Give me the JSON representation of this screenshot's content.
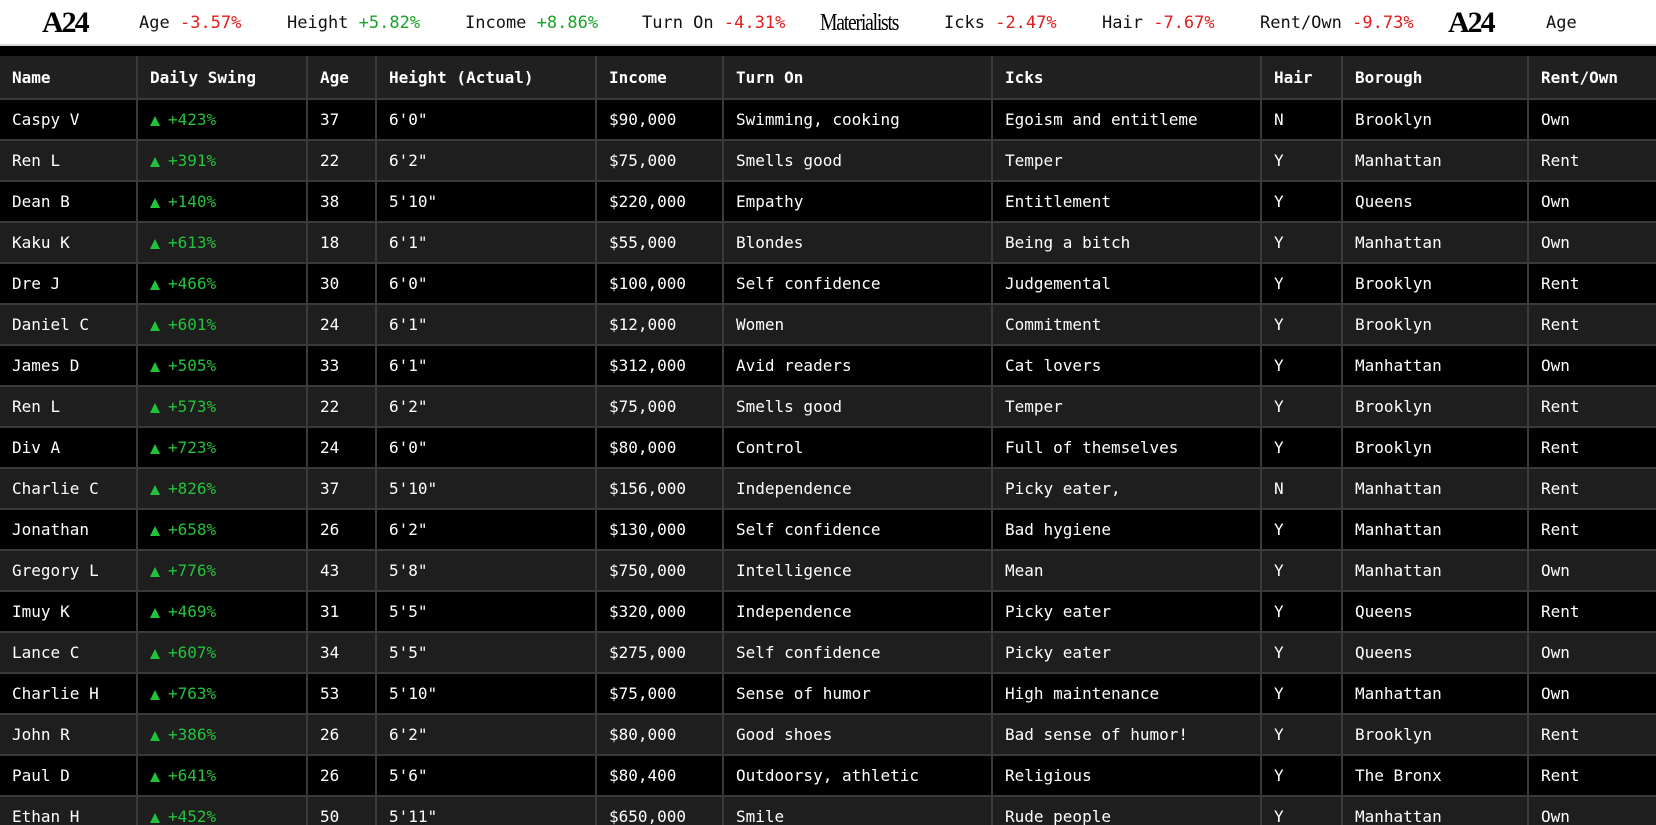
{
  "ticker": {
    "items": [
      {
        "type": "logo",
        "text": "A24"
      },
      {
        "type": "stat",
        "label": "Age",
        "value": "-3.57%",
        "trend": "down"
      },
      {
        "type": "stat",
        "label": "Height",
        "value": "+5.82%",
        "trend": "up"
      },
      {
        "type": "stat",
        "label": "Income",
        "value": "+8.86%",
        "trend": "up"
      },
      {
        "type": "stat",
        "label": "Turn On",
        "value": "-4.31%",
        "trend": "down"
      },
      {
        "type": "logo2",
        "text": "Materialists"
      },
      {
        "type": "stat",
        "label": "Icks",
        "value": "-2.47%",
        "trend": "down"
      },
      {
        "type": "stat",
        "label": "Hair",
        "value": "-7.67%",
        "trend": "down"
      },
      {
        "type": "stat",
        "label": "Rent/Own",
        "value": "-9.73%",
        "trend": "down"
      },
      {
        "type": "logo",
        "text": "A24"
      },
      {
        "type": "stat",
        "label": "Age",
        "value": "",
        "trend": "down"
      }
    ]
  },
  "table": {
    "headers": [
      "Name",
      "Daily Swing",
      "Age",
      "Height (Actual)",
      "Income",
      "Turn On",
      "Icks",
      "Hair",
      "Borough",
      "Rent/Own"
    ],
    "rows": [
      [
        "Caspy V",
        "+423%",
        "37",
        "6'0\"",
        "$90,000",
        "Swimming, cooking",
        "Egoism and entitleme",
        "N",
        "Brooklyn",
        "Own"
      ],
      [
        "Ren L",
        "+391%",
        "22",
        "6'2\"",
        "$75,000",
        "Smells good",
        "Temper",
        "Y",
        "Manhattan",
        "Rent"
      ],
      [
        "Dean B",
        "+140%",
        "38",
        "5'10\"",
        "$220,000",
        "Empathy",
        "Entitlement",
        "Y",
        "Queens",
        "Own"
      ],
      [
        "Kaku K",
        "+613%",
        "18",
        "6'1\"",
        "$55,000",
        "Blondes",
        "Being a bitch",
        "Y",
        "Manhattan",
        "Own"
      ],
      [
        "Dre J",
        "+466%",
        "30",
        "6'0\"",
        "$100,000",
        "Self confidence",
        "Judgemental",
        "Y",
        "Brooklyn",
        "Rent"
      ],
      [
        "Daniel C",
        "+601%",
        "24",
        "6'1\"",
        "$12,000",
        "Women",
        "Commitment",
        "Y",
        "Brooklyn",
        "Rent"
      ],
      [
        "James D",
        "+505%",
        "33",
        "6'1\"",
        "$312,000",
        "Avid readers",
        "Cat lovers",
        "Y",
        "Manhattan",
        "Own"
      ],
      [
        "Ren L",
        "+573%",
        "22",
        "6'2\"",
        "$75,000",
        "Smells good",
        "Temper",
        "Y",
        "Brooklyn",
        "Rent"
      ],
      [
        "Div A",
        "+723%",
        "24",
        "6'0\"",
        "$80,000",
        "Control",
        "Full of themselves",
        "Y",
        "Brooklyn",
        "Rent"
      ],
      [
        "Charlie C",
        "+826%",
        "37",
        "5'10\"",
        "$156,000",
        "Independence",
        "Picky eater,",
        "N",
        "Manhattan",
        "Rent"
      ],
      [
        "Jonathan",
        "+658%",
        "26",
        "6'2\"",
        "$130,000",
        "Self confidence",
        "Bad hygiene",
        "Y",
        "Manhattan",
        "Rent"
      ],
      [
        "Gregory L",
        "+776%",
        "43",
        "5'8\"",
        "$750,000",
        "Intelligence",
        "Mean",
        "Y",
        "Manhattan",
        "Own"
      ],
      [
        "Imuy K",
        "+469%",
        "31",
        "5'5\"",
        "$320,000",
        "Independence",
        "Picky eater",
        "Y",
        "Queens",
        "Rent"
      ],
      [
        "Lance C",
        "+607%",
        "34",
        "5'5\"",
        "$275,000",
        "Self confidence",
        "Picky eater",
        "Y",
        "Queens",
        "Own"
      ],
      [
        "Charlie H",
        "+763%",
        "53",
        "5'10\"",
        "$75,000",
        "Sense of humor",
        "High maintenance",
        "Y",
        "Manhattan",
        "Own"
      ],
      [
        "John R",
        "+386%",
        "26",
        "6'2\"",
        "$80,000",
        "Good shoes",
        "Bad sense of humor!",
        "Y",
        "Brooklyn",
        "Rent"
      ],
      [
        "Paul D",
        "+641%",
        "26",
        "5'6\"",
        "$80,400",
        "Outdoorsy, athletic",
        "Religious",
        "Y",
        "The Bronx",
        "Rent"
      ],
      [
        "Ethan H",
        "+452%",
        "50",
        "5'11\"",
        "$650,000",
        "Smile",
        "Rude people",
        "Y",
        "Manhattan",
        "Own"
      ]
    ]
  },
  "colors": {
    "up": "#19a32a",
    "down": "#e31c1c",
    "swing": "#22c33a"
  }
}
